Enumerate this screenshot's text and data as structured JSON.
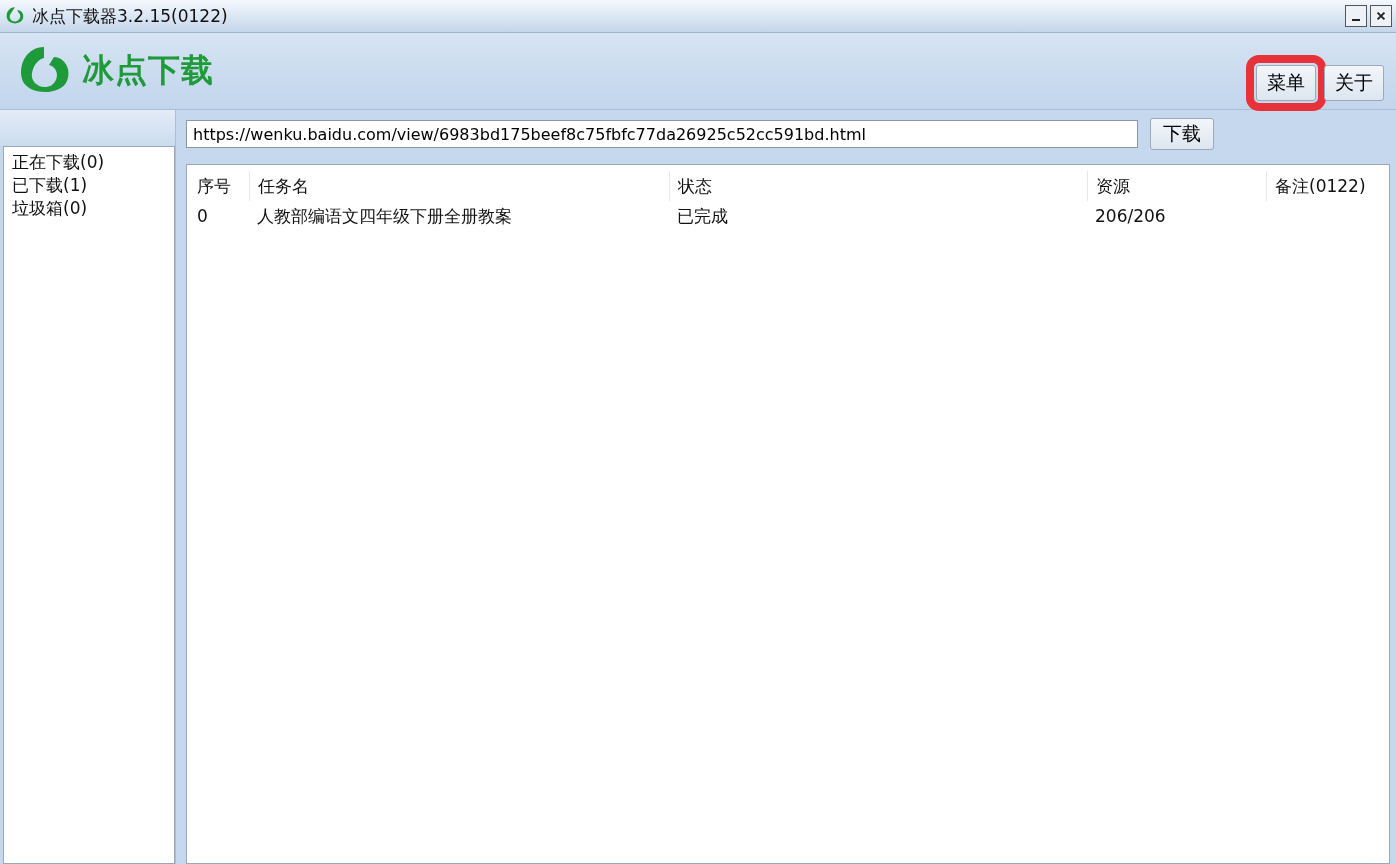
{
  "window": {
    "title": "冰点下载器3.2.15(0122)"
  },
  "header": {
    "brand": "冰点下载",
    "buttons": [
      {
        "label": "菜单",
        "highlighted": true
      },
      {
        "label": "关于",
        "highlighted": false
      }
    ]
  },
  "sidebar": {
    "items": [
      {
        "label": "正在下载(0)",
        "selected": false
      },
      {
        "label": "已下载(1)",
        "selected": false
      },
      {
        "label": "垃圾箱(0)",
        "selected": false
      }
    ]
  },
  "url_bar": {
    "value": "https://wenku.baidu.com/view/6983bd175beef8c75fbfc77da26925c52cc591bd.html",
    "button": "下载"
  },
  "table": {
    "columns": [
      "序号",
      "任务名",
      "状态",
      "资源",
      "备注(0122)"
    ],
    "rows": [
      [
        "0",
        "人教部编语文四年级下册全册教案",
        "已完成",
        "206/206",
        ""
      ]
    ]
  }
}
